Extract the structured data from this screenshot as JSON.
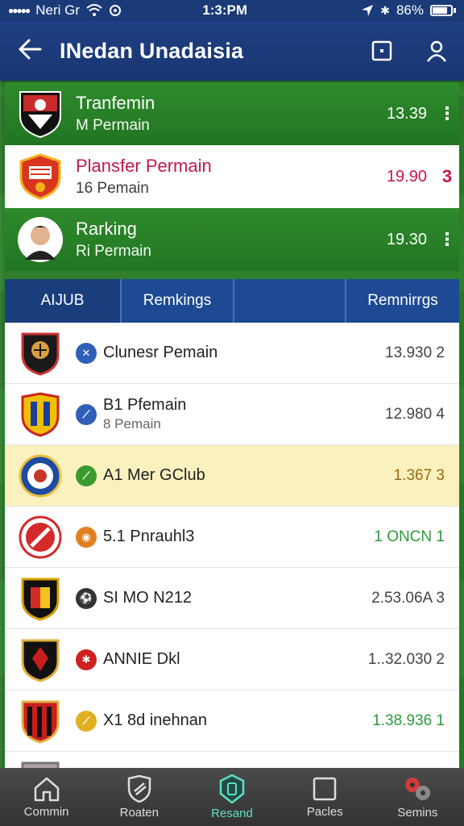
{
  "status_bar": {
    "carrier": "Neri Gr",
    "time": "1:3:PM",
    "battery": "86%"
  },
  "app_bar": {
    "title": "INedan Unadaisia"
  },
  "top_cards": [
    {
      "title": "Tranfemin",
      "subtitle": "M Permain",
      "value": "13.39",
      "more": "⋮",
      "style": "green"
    },
    {
      "title": "Plansfer Permain",
      "subtitle": "16 Pemain",
      "value": "19.90",
      "more": "3",
      "style": "white"
    },
    {
      "title": "Rarking",
      "subtitle": "Ri Permain",
      "value": "19.30",
      "more": "⋮",
      "style": "green"
    }
  ],
  "tabs": [
    "AIJUB",
    "Remkings",
    "",
    "Remnirrgs"
  ],
  "rows": [
    {
      "name": "Clunesr Pemain",
      "sub": "",
      "value": "13.930 2",
      "dot_color": "#2f5fb8",
      "value_style": ""
    },
    {
      "name": "B1 Pfemain",
      "sub": "8 Pemain",
      "value": "12.980 4",
      "dot_color": "#2f5fb8",
      "value_style": ""
    },
    {
      "name": "A1 Mer GClub",
      "sub": "",
      "value": "1.367 3",
      "dot_color": "#3a9a2e",
      "value_style": "amber",
      "highlight": true
    },
    {
      "name": "5.1 Pnrauhl3",
      "sub": "",
      "value": "1 ONCN 1",
      "dot_color": "#e08020",
      "value_style": "green"
    },
    {
      "name": "SI MO N212",
      "sub": "",
      "value": "2.53.06A 3",
      "dot_color": "#333333",
      "value_style": ""
    },
    {
      "name": "ANNIE Dkl",
      "sub": "",
      "value": "1..32.030 2",
      "dot_color": "#d02020",
      "value_style": ""
    },
    {
      "name": "X1 8d inehnan",
      "sub": "",
      "value": "1.38.936 1",
      "dot_color": "#e0b020",
      "value_style": "green"
    }
  ],
  "bottom_nav": [
    {
      "label": "Commin",
      "icon": "home-icon"
    },
    {
      "label": "Roaten",
      "icon": "shield-icon"
    },
    {
      "label": "Resand",
      "icon": "badge-icon",
      "active": true
    },
    {
      "label": "Pacles",
      "icon": "square-icon"
    },
    {
      "label": "Semins",
      "icon": "gears-icon"
    }
  ],
  "colors": {
    "app_bar": "#1e3f84",
    "field": "#2f7f2c",
    "accent_pink": "#c3184a",
    "active_nav": "#5fe0c4"
  }
}
